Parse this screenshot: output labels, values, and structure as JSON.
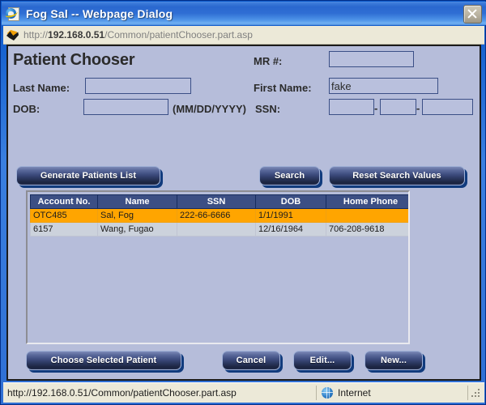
{
  "window": {
    "title": "Fog Sal -- Webpage Dialog",
    "app_icon": "internet-explorer-icon",
    "close_label": "×"
  },
  "address_bar": {
    "favicon": "page-favicon",
    "url_prefix": "http://",
    "url_host": "192.168.0.51",
    "url_path": "/Common/patientChooser.part.asp"
  },
  "form": {
    "page_title": "Patient Chooser",
    "mr_label": "MR #:",
    "mr_value": "",
    "mr_placeholder": "",
    "last_name_label": "Last Name:",
    "last_name_value": "",
    "first_name_label": "First Name:",
    "first_name_value": "fake",
    "dob_label": "DOB:",
    "dob_value": "",
    "dob_format_hint": "(MM/DD/YYYY)",
    "ssn_label": "SSN:",
    "ssn_part1": "",
    "ssn_part2": "",
    "ssn_part3": "",
    "ssn_separator": "-"
  },
  "search_buttons": {
    "generate": "Generate Patients List",
    "search": "Search",
    "reset": "Reset Search Values"
  },
  "results": {
    "columns": [
      "Account No.",
      "Name",
      "SSN",
      "DOB",
      "Home Phone"
    ],
    "rows": [
      {
        "account_no": "OTC485",
        "name": "Sal, Fog",
        "ssn": "222-66-6666",
        "dob": "1/1/1991",
        "home_phone": "",
        "selected": true
      },
      {
        "account_no": "6157",
        "name": "Wang, Fugao",
        "ssn": "",
        "dob": "12/16/1964",
        "home_phone": "706-208-9618",
        "selected": false
      }
    ]
  },
  "action_buttons": {
    "choose": "Choose Selected Patient",
    "cancel": "Cancel",
    "edit": "Edit...",
    "new": "New..."
  },
  "status_bar": {
    "url": "http://192.168.0.51/Common/patientChooser.part.asp",
    "zone_icon": "globe-icon",
    "zone_label": "Internet"
  },
  "colors": {
    "titlebar_blue": "#2f6fd4",
    "content_bg": "#b6bdda",
    "input_bg": "#b9c0dd",
    "button_dark": "#1b2440",
    "button_shadow": "#113b7d",
    "table_header": "#3c4f84",
    "row_selected": "#ffa500",
    "row_normal": "#ccd2dc",
    "status_bg": "#ece9d8"
  }
}
